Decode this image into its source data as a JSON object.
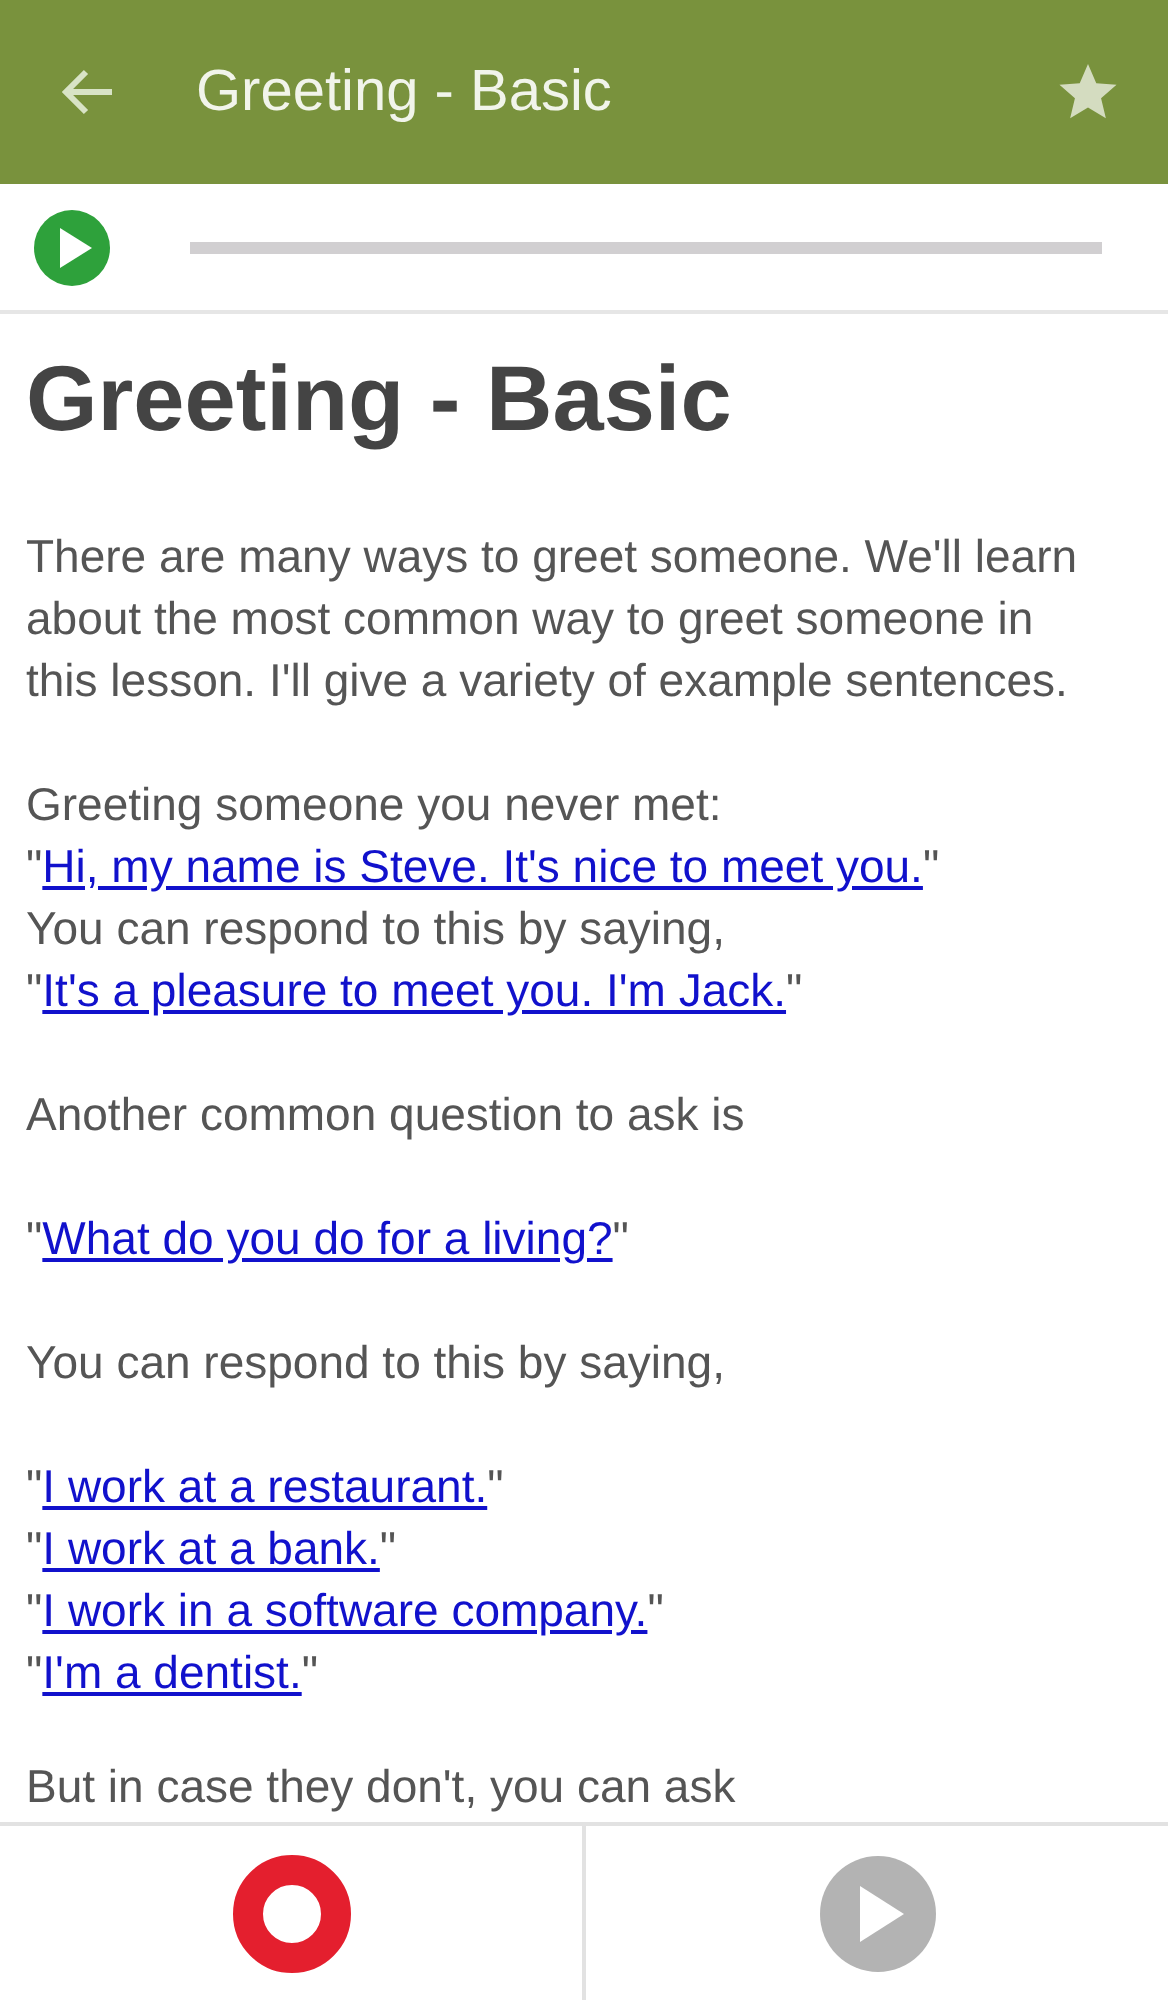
{
  "app_bar": {
    "title": "Greeting - Basic"
  },
  "lesson": {
    "title": "Greeting - Basic",
    "paragraphs": [
      {
        "lines": [
          [
            {
              "text": "There are many ways to greet someone. We'll learn about the most common way to greet someone in this lesson. I'll give a variety of example sentences.",
              "link": false
            }
          ]
        ]
      },
      {
        "lines": [
          [
            {
              "text": "Greeting someone you never met:",
              "link": false
            }
          ],
          [
            {
              "text": "\"",
              "link": false
            },
            {
              "text": "Hi, my name is Steve. It's nice to meet you.",
              "link": true
            },
            {
              "text": "\"",
              "link": false
            }
          ],
          [
            {
              "text": "You can respond to this by saying,",
              "link": false
            }
          ],
          [
            {
              "text": "\"",
              "link": false
            },
            {
              "text": "It's a pleasure to meet you. I'm Jack.",
              "link": true
            },
            {
              "text": "\"",
              "link": false
            }
          ]
        ]
      },
      {
        "lines": [
          [
            {
              "text": "Another common question to ask is",
              "link": false
            }
          ]
        ]
      },
      {
        "lines": [
          [
            {
              "text": "\"",
              "link": false
            },
            {
              "text": "What do you do for a living?",
              "link": true
            },
            {
              "text": "\"",
              "link": false
            }
          ]
        ]
      },
      {
        "lines": [
          [
            {
              "text": "You can respond to this by saying,",
              "link": false
            }
          ]
        ]
      },
      {
        "lines": [
          [
            {
              "text": "\"",
              "link": false
            },
            {
              "text": "I work at a restaurant.",
              "link": true
            },
            {
              "text": "\"",
              "link": false
            }
          ],
          [
            {
              "text": "\"",
              "link": false
            },
            {
              "text": "I work at a bank.",
              "link": true
            },
            {
              "text": "\"",
              "link": false
            }
          ],
          [
            {
              "text": "\"",
              "link": false
            },
            {
              "text": "I work in a software company.",
              "link": true
            },
            {
              "text": "\"",
              "link": false
            }
          ],
          [
            {
              "text": "\"",
              "link": false
            },
            {
              "text": "I'm a dentist.",
              "link": true
            },
            {
              "text": "\"",
              "link": false
            }
          ]
        ]
      },
      {
        "lines": [
          [
            {
              "text": "But in case they don't, you can ask",
              "link": false
            }
          ]
        ]
      }
    ]
  }
}
